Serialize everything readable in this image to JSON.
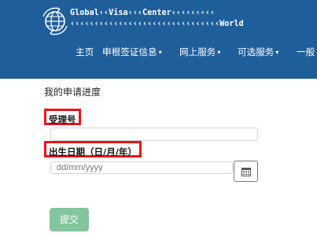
{
  "header": {
    "brand_line1": "Global‹‹Visa‹‹‹Center‹‹‹‹‹‹‹‹‹",
    "brand_line2": "‹‹‹‹‹‹‹‹‹‹‹‹‹‹‹‹‹‹‹‹‹‹‹‹‹‹‹‹‹‹‹World",
    "background": "#1e5e9b",
    "logo_icon": "globe-icon"
  },
  "nav": {
    "home": "主页",
    "apply_info": "申根签证信息",
    "online_services": "网上服务",
    "optional_services": "可选服务",
    "general": "一般",
    "caret": "▾"
  },
  "form": {
    "page_title": "我的申请进度",
    "reference_label": "受理号",
    "reference_value": "",
    "dob_label": "出生日期（日/月/年）",
    "dob_placeholder": "dd/mm/yyyy",
    "calendar_icon": "calendar-icon",
    "submit_label": "提交",
    "submit_color": "#83c59c",
    "highlight_color": "#e8141a"
  }
}
